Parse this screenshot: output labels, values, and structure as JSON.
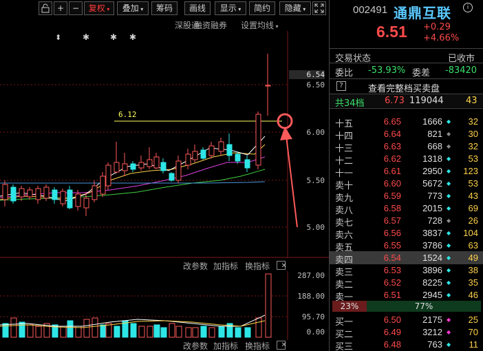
{
  "toolbar": {
    "buttons": [
      "+",
      "−",
      "复权",
      "叠加",
      "筹码",
      "画线",
      "显示",
      "简约",
      "隐藏"
    ],
    "subbar": [
      "深股通",
      "融资融券",
      "设置均线"
    ]
  },
  "price_axis": {
    "labels": [
      "6.54",
      "6.50",
      "6.00",
      "5.50",
      "5.00"
    ]
  },
  "annotation": {
    "line_label": "6.12"
  },
  "markers": [
    "⬍",
    "✱",
    "✱",
    "✱"
  ],
  "volume_axis": {
    "labels": [
      "287.00",
      "188.00",
      "95.70",
      "0.00"
    ]
  },
  "volume_menu": {
    "items": [
      "改参数",
      "加指标",
      "换指标"
    ]
  },
  "stock": {
    "code": "002491",
    "name": "通鼎互联",
    "price": "6.51",
    "change": "+0.29",
    "change_pct": "+4.66%"
  },
  "status": {
    "label": "交易状态",
    "value": "已收市",
    "wb_label": "委比",
    "wb_value": "-53.93%",
    "wc_label": "委差",
    "wc_value": "-83420",
    "full_book": "查看完整档买卖盘",
    "levels_label": "共34档",
    "levels_price": "6.73",
    "levels_vol": "119044",
    "levels_cnt": "43"
  },
  "asks": [
    {
      "label": "十五",
      "price": "6.65",
      "vol": "1666",
      "cnt": "32",
      "dot": "cyan"
    },
    {
      "label": "十四",
      "price": "6.64",
      "vol": "821",
      "cnt": "30",
      "dot": "gray"
    },
    {
      "label": "十三",
      "price": "6.63",
      "vol": "668",
      "cnt": "32",
      "dot": "gray"
    },
    {
      "label": "十二",
      "price": "6.62",
      "vol": "1318",
      "cnt": "53",
      "dot": "cyan"
    },
    {
      "label": "十一",
      "price": "6.61",
      "vol": "2950",
      "cnt": "123",
      "dot": "cyan"
    },
    {
      "label": "卖十",
      "price": "6.60",
      "vol": "5672",
      "cnt": "53",
      "dot": "cyan"
    },
    {
      "label": "卖九",
      "price": "6.59",
      "vol": "773",
      "cnt": "43",
      "dot": "cyan"
    },
    {
      "label": "卖八",
      "price": "6.58",
      "vol": "2015",
      "cnt": "69",
      "dot": "cyan"
    },
    {
      "label": "卖七",
      "price": "6.57",
      "vol": "728",
      "cnt": "26",
      "dot": "gray"
    },
    {
      "label": "卖六",
      "price": "6.56",
      "vol": "3837",
      "cnt": "104",
      "dot": "cyan"
    },
    {
      "label": "卖五",
      "price": "6.55",
      "vol": "3786",
      "cnt": "63",
      "dot": "cyan"
    },
    {
      "label": "卖四",
      "price": "6.54",
      "vol": "1524",
      "cnt": "49",
      "dot": "cyan"
    },
    {
      "label": "卖三",
      "price": "6.53",
      "vol": "3896",
      "cnt": "38",
      "dot": "cyan"
    },
    {
      "label": "卖二",
      "price": "6.52",
      "vol": "8225",
      "cnt": "35",
      "dot": "cyan"
    },
    {
      "label": "卖一",
      "price": "6.51",
      "vol": "2945",
      "cnt": "46",
      "dot": "cyan"
    }
  ],
  "ratio": {
    "buy_pct": "23%",
    "sell_pct": "77%"
  },
  "bids": [
    {
      "label": "买一",
      "price": "6.50",
      "vol": "2175",
      "cnt": "25",
      "dot": "magenta"
    },
    {
      "label": "买二",
      "price": "6.49",
      "vol": "3212",
      "cnt": "70",
      "dot": "magenta"
    },
    {
      "label": "买三",
      "price": "6.48",
      "vol": "763",
      "cnt": "11",
      "dot": "cyan"
    }
  ],
  "colors": {
    "up": "#ff4a4a",
    "down": "#2ee6e6",
    "name": "#5ac8ff",
    "count": "#ffd24a",
    "ma5": "#ffffff",
    "ma10": "#ffd24a",
    "ma20": "#e040e0",
    "ma60": "#40d040"
  }
}
